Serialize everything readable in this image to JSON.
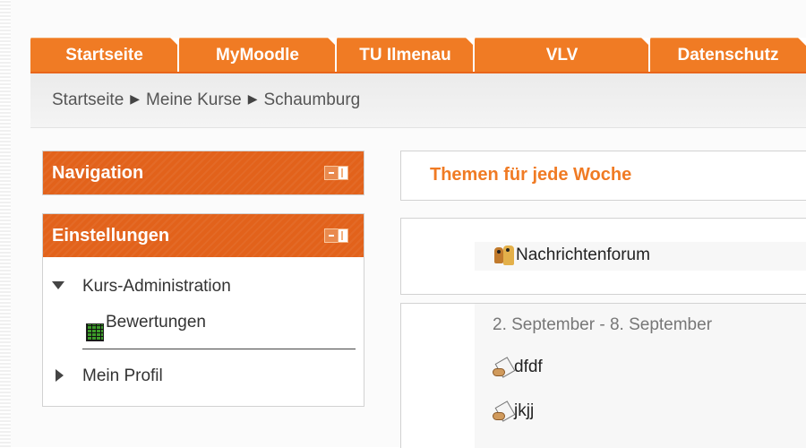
{
  "tabs": [
    {
      "label": "Startseite"
    },
    {
      "label": "MyMoodle"
    },
    {
      "label": "TU Ilmenau"
    },
    {
      "label": "VLV"
    },
    {
      "label": "Datenschutz"
    }
  ],
  "breadcrumb": {
    "items": [
      "Startseite",
      "Meine Kurse",
      "Schaumburg"
    ],
    "separator": "▶"
  },
  "navigation_block": {
    "title": "Navigation",
    "dock_icon": "dock-to-sidebar-icon"
  },
  "settings_block": {
    "title": "Einstellungen",
    "dock_icon": "dock-to-sidebar-icon",
    "items": [
      {
        "label": "Kurs-Administration",
        "icon": "triangle-down-icon"
      },
      {
        "label": "Bewertungen",
        "icon": "grades-icon"
      },
      {
        "label": "Mein Profil",
        "icon": "triangle-right-icon"
      }
    ]
  },
  "course": {
    "format_title": "Themen für jede Woche",
    "general_section": {
      "activities": [
        {
          "label": "Nachrichtenforum",
          "icon": "forum-icon"
        }
      ]
    },
    "week_section": {
      "title": "2. September - 8. September",
      "activities": [
        {
          "label": "dfdf",
          "icon": "assignment-icon"
        },
        {
          "label": "jkjj",
          "icon": "assignment-icon"
        }
      ]
    }
  },
  "colors": {
    "accent": "#f07b24",
    "block_header": "#e2621b",
    "heading_text": "#f07b24"
  }
}
